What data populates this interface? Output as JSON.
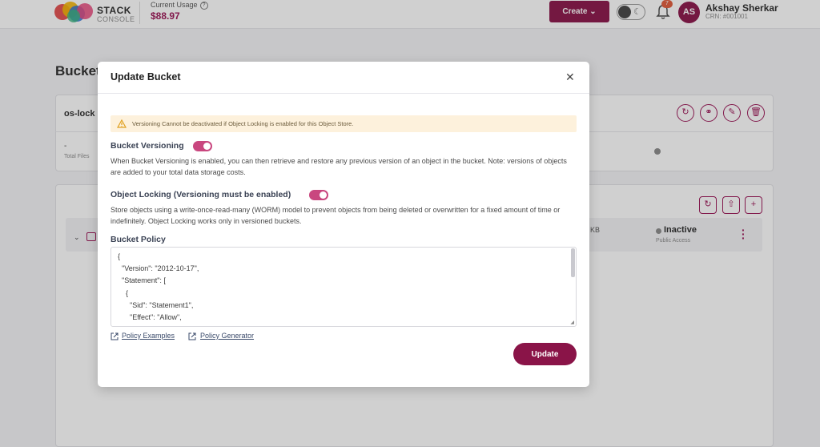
{
  "brand": {
    "name": "STACK",
    "sub": "CONSOLE"
  },
  "usage": {
    "label": "Current Usage",
    "value": "$88.97"
  },
  "header": {
    "create_label": "Create",
    "notifications_count": "7"
  },
  "user": {
    "initials": "AS",
    "name": "Akshay Sherkar",
    "crn": "CRN: #001001"
  },
  "page": {
    "title": "Bucket",
    "bucket_name": "os-lock",
    "files_value": "-",
    "files_label": "Total Files",
    "row": {
      "size_suffix": "KB",
      "status": "Inactive",
      "access": "Public Access"
    }
  },
  "modal": {
    "title": "Update Bucket",
    "warning": "Versioning Cannot be deactivated if Object Locking is enabled for this Object Store.",
    "versioning": {
      "title": "Bucket Versioning",
      "enabled": true,
      "description": "When Bucket Versioning is enabled, you can then retrieve and restore any previous version of an object in the bucket. Note: versions of objects are added to your total data storage costs."
    },
    "locking": {
      "title": "Object Locking (Versioning must be enabled)",
      "enabled": true,
      "description": "Store objects using a write-once-read-many (WORM) model to prevent objects from being deleted or overwritten for a fixed amount of time or indefinitely. Object Locking works only in versioned buckets."
    },
    "policy": {
      "title": "Bucket Policy",
      "value": "{\n  \"Version\": \"2012-10-17\",\n  \"Statement\": [\n    {\n      \"Sid\": \"Statement1\",\n      \"Effect\": \"Allow\",\n      \"Principal\": \"*\","
    },
    "links": {
      "examples": "Policy Examples",
      "generator": "Policy Generator"
    },
    "update_label": "Update"
  },
  "colors": {
    "brand": "#8a1448",
    "toggle_on": "#c9477f",
    "warning_bg": "#fdf1dc"
  }
}
